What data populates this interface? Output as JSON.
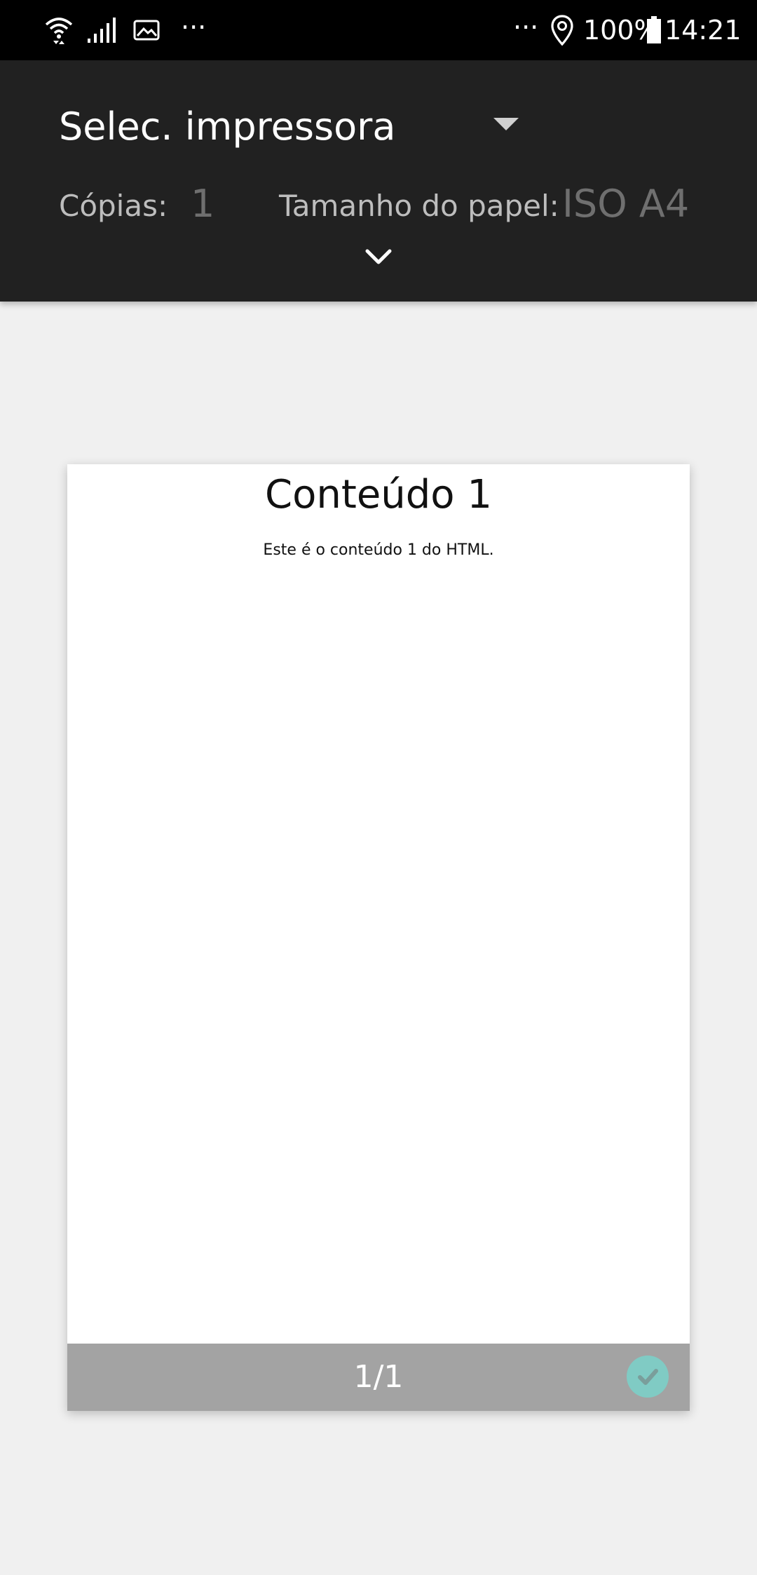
{
  "status_bar": {
    "left_icons": [
      "wifi-icon",
      "signal-icon",
      "image-icon"
    ],
    "left_overflow": "···",
    "right_overflow": "···",
    "battery_percent": "100%",
    "time": "14:21"
  },
  "print_header": {
    "printer_select_label": "Selec. impressora",
    "copies_label": "Cópias:",
    "copies_value": "1",
    "paper_size_label": "Tamanho do papel:",
    "paper_size_value": "ISO A4"
  },
  "preview": {
    "heading": "Conteúdo 1",
    "body_text": "Este é o conteúdo 1 do HTML.",
    "page_counter": "1/1"
  },
  "colors": {
    "header_bg": "#212121",
    "status_bar_bg": "#000000",
    "canvas_bg": "#f0f0f0",
    "page_footer_bg": "#a3a3a3",
    "check_accent": "#80cbc4"
  }
}
